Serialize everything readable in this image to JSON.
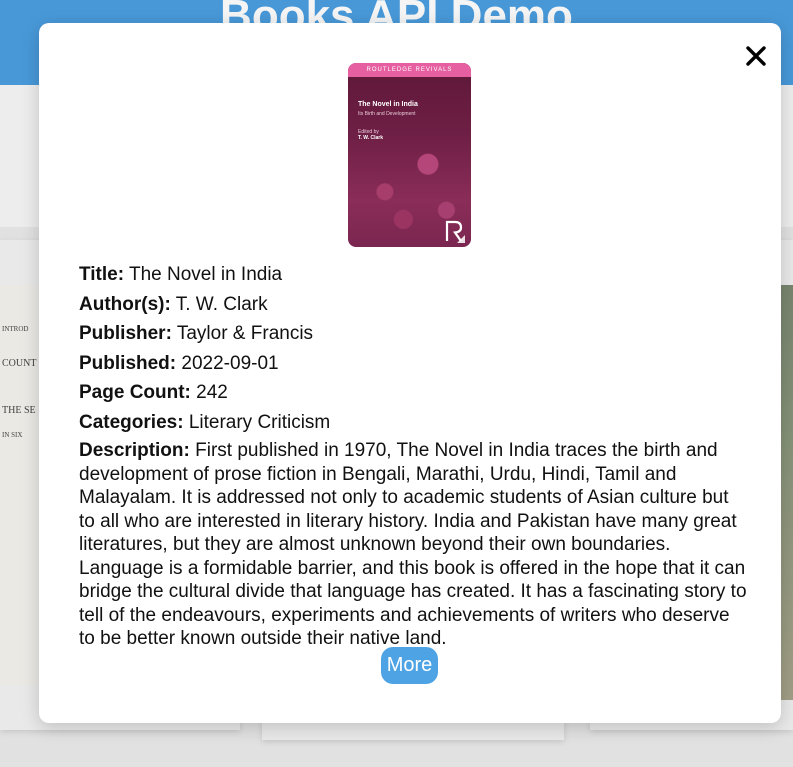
{
  "app": {
    "title": "Books API Demo"
  },
  "modal": {
    "cover_band_text": "ROUTLEDGE REVIVALS",
    "cover_title": "The Novel in India",
    "cover_subtitle": "Its Birth and Development",
    "cover_editor_label": "Edited by",
    "cover_editor": "T. W. Clark",
    "fields": {
      "title_label": "Title:",
      "title": "The Novel in India",
      "authors_label": "Author(s):",
      "authors": "T. W. Clark",
      "publisher_label": "Publisher:",
      "publisher": "Taylor & Francis",
      "published_label": "Published:",
      "published": "2022-09-01",
      "page_count_label": "Page Count:",
      "page_count": "242",
      "categories_label": "Categories:",
      "categories": "Literary Criticism",
      "description_label": "Description:",
      "description": "First published in 1970, The Novel in India traces the birth and development of prose fiction in Bengali, Marathi, Urdu, Hindi, Tamil and Malayalam. It is addressed not only to academic students of Asian culture but to all who are interested in literary history. India and Pakistan have many great literatures, but they are almost unknown beyond their own boundaries. Language is a formidable barrier, and this book is offered in the hope that it can bridge the cultural divide that language has created. It has a fascinating story to tell of the endeavours, experiments and achievements of writers who deserve to be better known outside their native land."
    },
    "more_label": "More",
    "close_icon": "close-icon"
  },
  "background_scan": [
    "INTROD",
    "COUNT",
    "THE SE",
    "IN SIX"
  ],
  "colors": {
    "header": "#4b9fe1",
    "more_button": "#4da3e3",
    "cover_band": "#e65fa0"
  }
}
